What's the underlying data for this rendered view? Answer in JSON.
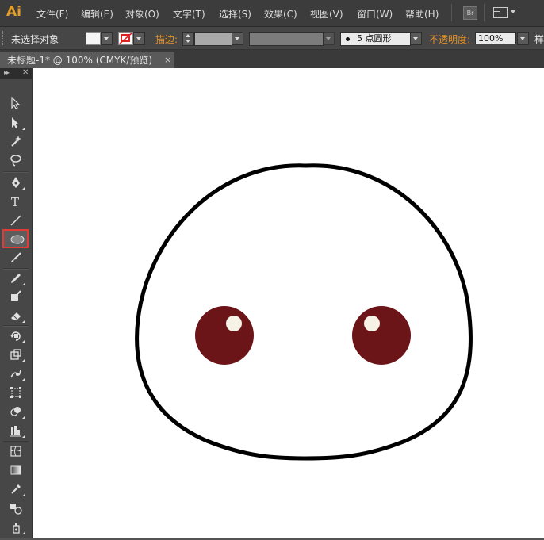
{
  "app": {
    "logo": "Ai"
  },
  "menu": {
    "items": [
      {
        "label": "文件(F)"
      },
      {
        "label": "编辑(E)"
      },
      {
        "label": "对象(O)"
      },
      {
        "label": "文字(T)"
      },
      {
        "label": "选择(S)"
      },
      {
        "label": "效果(C)"
      },
      {
        "label": "视图(V)"
      },
      {
        "label": "窗口(W)"
      },
      {
        "label": "帮助(H)"
      }
    ],
    "bridge_label": "Br"
  },
  "control": {
    "selection_label": "未选择对象",
    "fill_color": "#f5f5f5",
    "stroke_label": "描边:",
    "brush_label": "5 点圆形",
    "opacity_label": "不透明度:",
    "opacity_value": "100%",
    "style_label": "样"
  },
  "document": {
    "tab_title": "未标题-1* @ 100% (CMYK/预览)",
    "close_glyph": "×"
  },
  "toolbox": {
    "header_chevron": "▸▸",
    "header_close": "✕",
    "tools": [
      "selection-tool",
      "direct-selection-tool",
      "magic-wand-tool",
      "lasso-tool",
      "pen-tool",
      "type-tool",
      "line-segment-tool",
      "ellipse-tool",
      "paintbrush-tool",
      "pencil-tool",
      "blob-brush-tool",
      "eraser-tool",
      "rotate-tool",
      "scale-tool",
      "warp-tool",
      "free-transform-tool",
      "shape-builder-tool",
      "graph-tool",
      "mesh-tool",
      "gradient-tool",
      "eyedropper-tool",
      "blend-tool",
      "symbol-sprayer-tool"
    ],
    "active_tool": "ellipse-tool"
  },
  "artwork": {
    "outline_color": "#000000",
    "eye_color": "#6b1518",
    "highlight_color": "#f7f2e6"
  }
}
